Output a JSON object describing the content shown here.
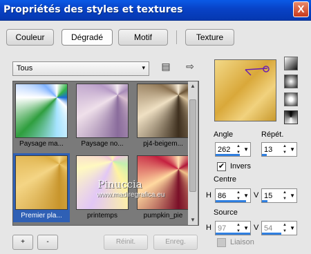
{
  "window": {
    "title": "Propriétés des styles et textures",
    "close_glyph": "X"
  },
  "tabs": [
    {
      "label": "Couleur"
    },
    {
      "label": "Dégradé"
    },
    {
      "label": "Motif"
    },
    {
      "label": "Texture"
    }
  ],
  "filter": {
    "selected": "Tous",
    "arrow": "▾"
  },
  "icons": {
    "library": "▤",
    "forward": "⇨",
    "scroll_up": "▲",
    "scroll_down": "▼"
  },
  "gradients": [
    {
      "name": "Paysage ma...",
      "icon": "gradient-thumbnail-icon"
    },
    {
      "name": "Paysage no...",
      "icon": "gradient-thumbnail-icon"
    },
    {
      "name": "pj4-beigem...",
      "icon": "gradient-thumbnail-icon"
    },
    {
      "name": "Premier pla...",
      "icon": "gradient-thumbnail-icon"
    },
    {
      "name": "printemps",
      "icon": "gradient-thumbnail-icon"
    },
    {
      "name": "pumpkin_pie",
      "icon": "gradient-thumbnail-icon"
    }
  ],
  "selected_gradient": "Premier pla...",
  "watermark": {
    "line1": "Pinuccia",
    "line2": "www.madiregrafica.eu"
  },
  "buttons": {
    "add": "+",
    "remove": "-",
    "reinit": "Réinit.",
    "save": "Enreg."
  },
  "settings": {
    "angle_label": "Angle",
    "angle_value": "262",
    "repeat_label": "Répét.",
    "repeat_value": "13",
    "invert_label": "Invers",
    "invert_checked": true,
    "center_label": "Centre",
    "center_h_label": "H",
    "center_h": "86",
    "center_v_label": "V",
    "center_v": "15",
    "source_label": "Source",
    "source_h_label": "H",
    "source_h": "97",
    "source_v_label": "V",
    "source_v": "54",
    "link_label": "Liaison",
    "link_checked": false
  },
  "colors": {
    "accent": "#2f60b5",
    "titlebar": "#0842c6",
    "close": "#c8391b"
  }
}
